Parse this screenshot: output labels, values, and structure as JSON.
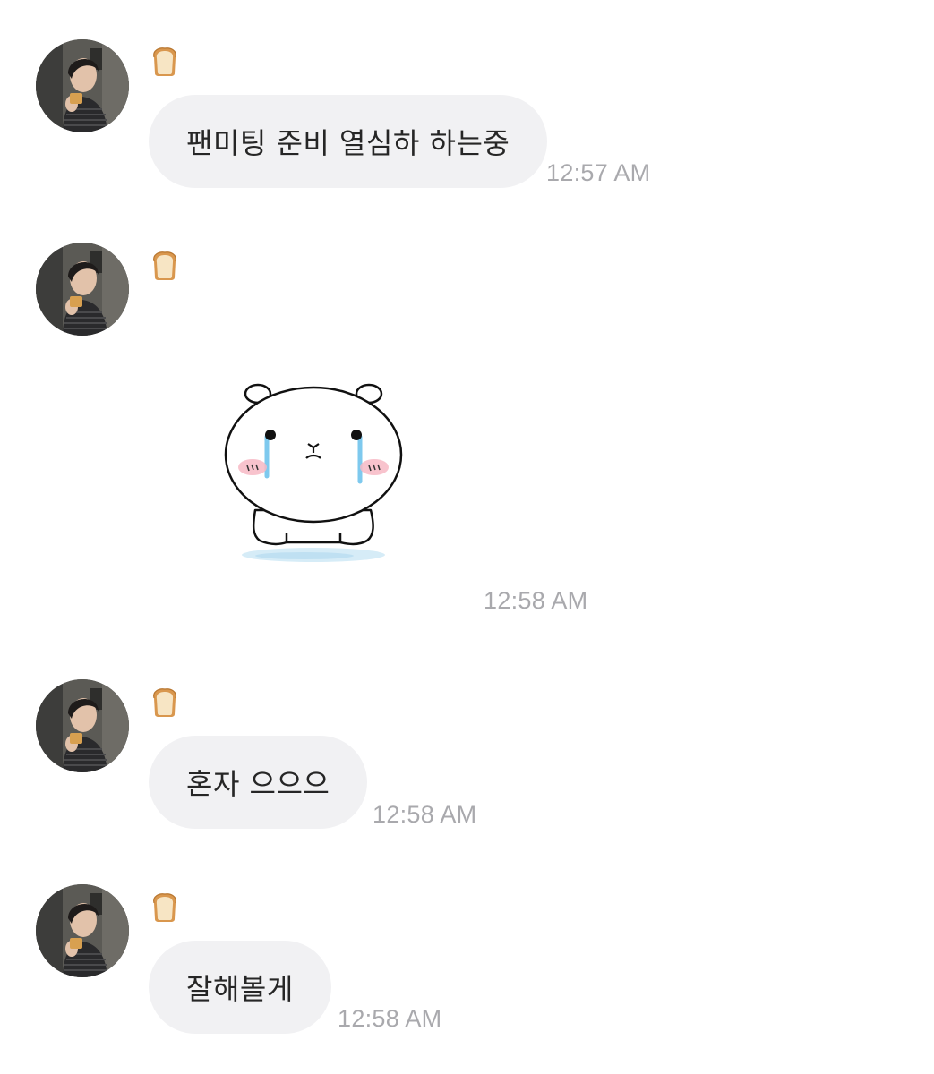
{
  "conversation": {
    "sender_icon": "bread-emoji-icon",
    "avatar": "profile-photo-avatar",
    "messages": [
      {
        "type": "text",
        "text": "팬미팅 준비 열심하 하는중",
        "time": "12:57 AM"
      },
      {
        "type": "sticker",
        "sticker": "crying-white-bear-sticker",
        "time": "12:58 AM"
      },
      {
        "type": "text",
        "text": "혼자 으으으",
        "time": "12:58 AM"
      },
      {
        "type": "text",
        "text": "잘해볼게",
        "time": "12:58 AM"
      }
    ]
  },
  "colors": {
    "bubble": "#f1f1f3",
    "text": "#262626",
    "timestamp": "#a9a9ad",
    "background": "#ffffff"
  }
}
